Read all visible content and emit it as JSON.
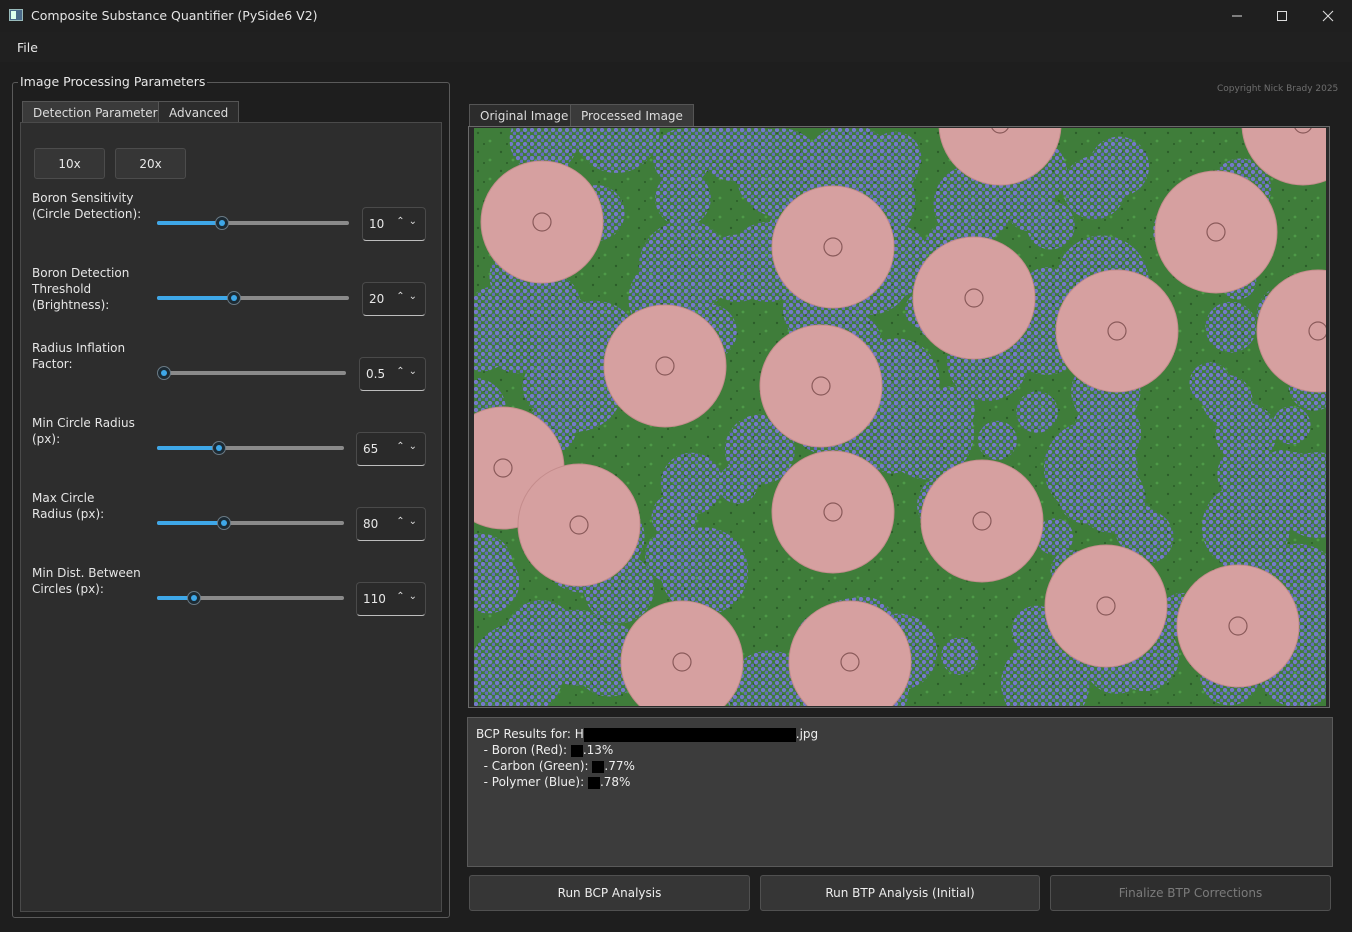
{
  "window": {
    "title": "Composite Substance Quantifier (PySide6 V2)",
    "minimize_icon": "minimize-icon",
    "maximize_icon": "maximize-icon",
    "close_icon": "close-icon"
  },
  "menu": {
    "file": "File"
  },
  "params_group": {
    "title": "Image Processing Parameters",
    "tabs": [
      "Detection Parameters",
      "Advanced"
    ],
    "active_tab": "Detection Parameters",
    "zoom_buttons": [
      "10x",
      "20x"
    ],
    "parameters": [
      {
        "label": "Boron Sensitivity (Circle Detection):",
        "value": "10",
        "slider_fraction": 0.34
      },
      {
        "label": "Boron Detection Threshold (Brightness):",
        "value": "20",
        "slider_fraction": 0.4
      },
      {
        "label": "Radius Inflation Factor:",
        "value": "0.5",
        "slider_fraction": 0.0
      },
      {
        "label": "Min Circle Radius (px):",
        "value": "65",
        "slider_fraction": 0.33
      },
      {
        "label": "Max Circle Radius (px):",
        "value": "80",
        "slider_fraction": 0.36
      },
      {
        "label": "Min Dist. Between Circles (px):",
        "value": "110",
        "slider_fraction": 0.2
      }
    ]
  },
  "copyright": "Copyright Nick Brady 2025",
  "image_tabs": [
    "Original Image",
    "Processed Image"
  ],
  "active_image_tab": "Processed Image",
  "colors": {
    "boron": "#d6a0a0",
    "carbon": "#3f7d3a",
    "polymer": "#6f77c9",
    "accent": "#3ea7e8"
  },
  "results": {
    "header_prefix": "BCP Results for: H",
    "header_suffix": ".jpg",
    "boron_label": "  - Boron (Red): ",
    "boron_value": ".13%",
    "carbon_label": "  - Carbon (Green): ",
    "carbon_value": ".77%",
    "polymer_label": "  - Polymer (Blue): ",
    "polymer_value": ".78%"
  },
  "actions": {
    "run_bcp": "Run BCP Analysis",
    "run_btp": "Run BTP Analysis (Initial)",
    "finalize_btp": "Finalize BTP Corrections"
  }
}
